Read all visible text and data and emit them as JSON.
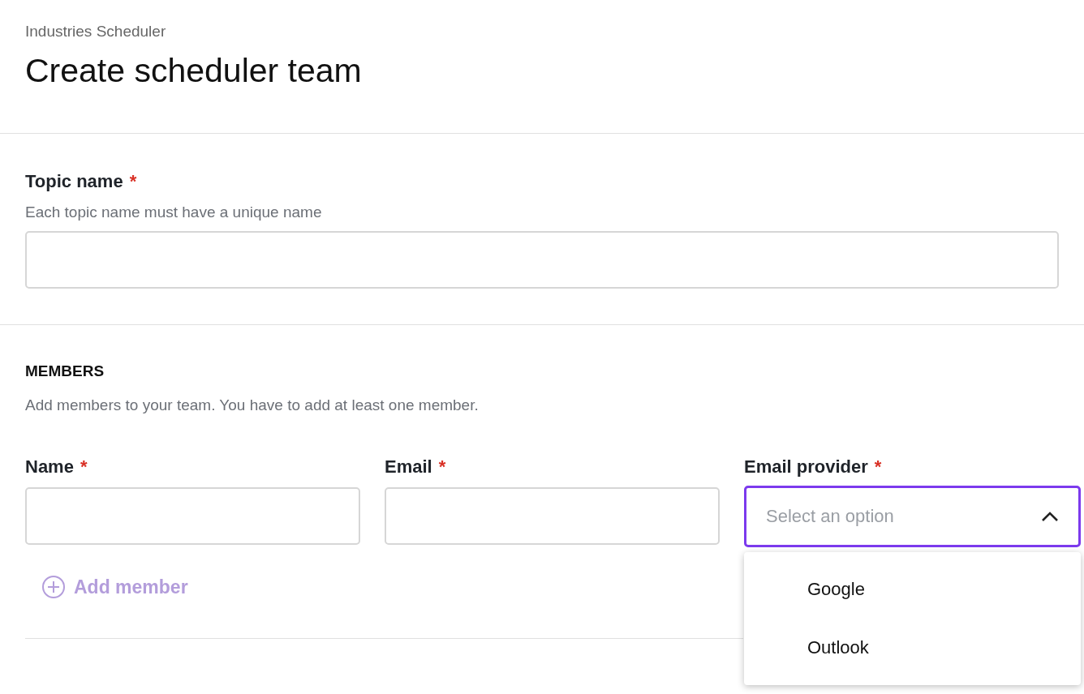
{
  "header": {
    "breadcrumb": "Industries Scheduler",
    "title": "Create scheduler team"
  },
  "topic": {
    "label": "Topic name",
    "required_mark": "*",
    "help": "Each topic name must have a unique name"
  },
  "members": {
    "heading": "MEMBERS",
    "description": "Add members to your team. You have to add at least one member.",
    "fields": [
      {
        "kind": "text",
        "label": "Name",
        "required_mark": "*"
      },
      {
        "kind": "text",
        "label": "Email",
        "required_mark": "*"
      },
      {
        "kind": "select",
        "label": "Email provider",
        "required_mark": "*",
        "placeholder": "Select an option",
        "expanded": true,
        "options": [
          "Google",
          "Outlook"
        ]
      }
    ],
    "add_button": "Add member"
  }
}
